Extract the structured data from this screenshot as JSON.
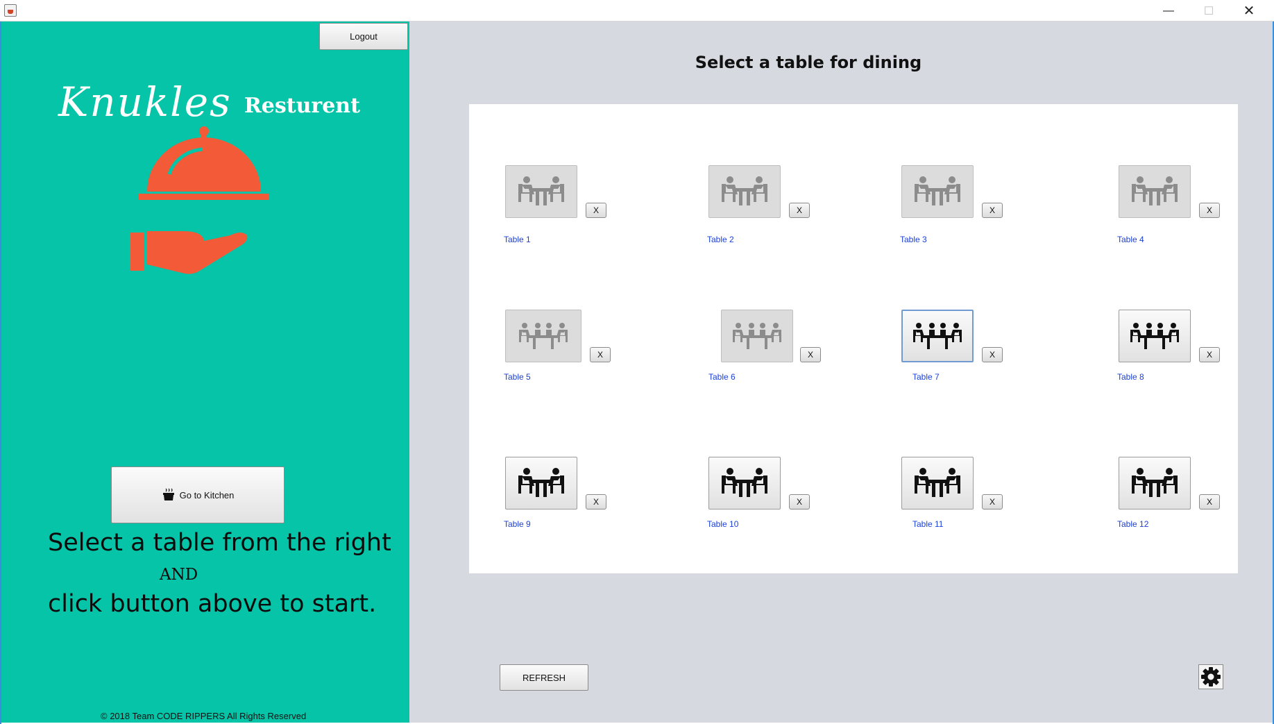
{
  "window": {
    "minimize": "—",
    "maximize": "☐",
    "close": "✕"
  },
  "left": {
    "logout_label": "Logout",
    "logo_script": "Knukles",
    "logo_word": "Resturent",
    "kitchen_label": "Go to Kitchen",
    "instruction_line1": "Select a table from the right",
    "instruction_and": "AND",
    "instruction_line2": "click button above to start.",
    "copyright": "© 2018 Team CODE RIPPERS All Rights Reserved",
    "accent_color": "#06c4a7",
    "logo_icon_color": "#f25a38"
  },
  "main": {
    "title": "Select a table for dining",
    "refresh_label": "REFRESH",
    "tables": [
      {
        "label": "Table 1",
        "x_label": "X",
        "status": "reserved",
        "seats": 2
      },
      {
        "label": "Table 2",
        "x_label": "X",
        "status": "reserved",
        "seats": 2
      },
      {
        "label": "Table 3",
        "x_label": "X",
        "status": "reserved",
        "seats": 2
      },
      {
        "label": "Table 4",
        "x_label": "X",
        "status": "reserved",
        "seats": 2
      },
      {
        "label": "Table 5",
        "x_label": "X",
        "status": "reserved",
        "seats": 4
      },
      {
        "label": "Table 6",
        "x_label": "X",
        "status": "reserved",
        "seats": 4
      },
      {
        "label": "Table 7",
        "x_label": "X",
        "status": "selected",
        "seats": 4
      },
      {
        "label": "Table 8",
        "x_label": "X",
        "status": "available",
        "seats": 4
      },
      {
        "label": "Table 9",
        "x_label": "X",
        "status": "available",
        "seats": 2
      },
      {
        "label": "Table 10",
        "x_label": "X",
        "status": "available",
        "seats": 2
      },
      {
        "label": "Table 11",
        "x_label": "X",
        "status": "available",
        "seats": 2
      },
      {
        "label": "Table 12",
        "x_label": "X",
        "status": "available",
        "seats": 2
      }
    ],
    "label_color": "#1a3fd6",
    "panel_bg": "#d6d9df"
  }
}
